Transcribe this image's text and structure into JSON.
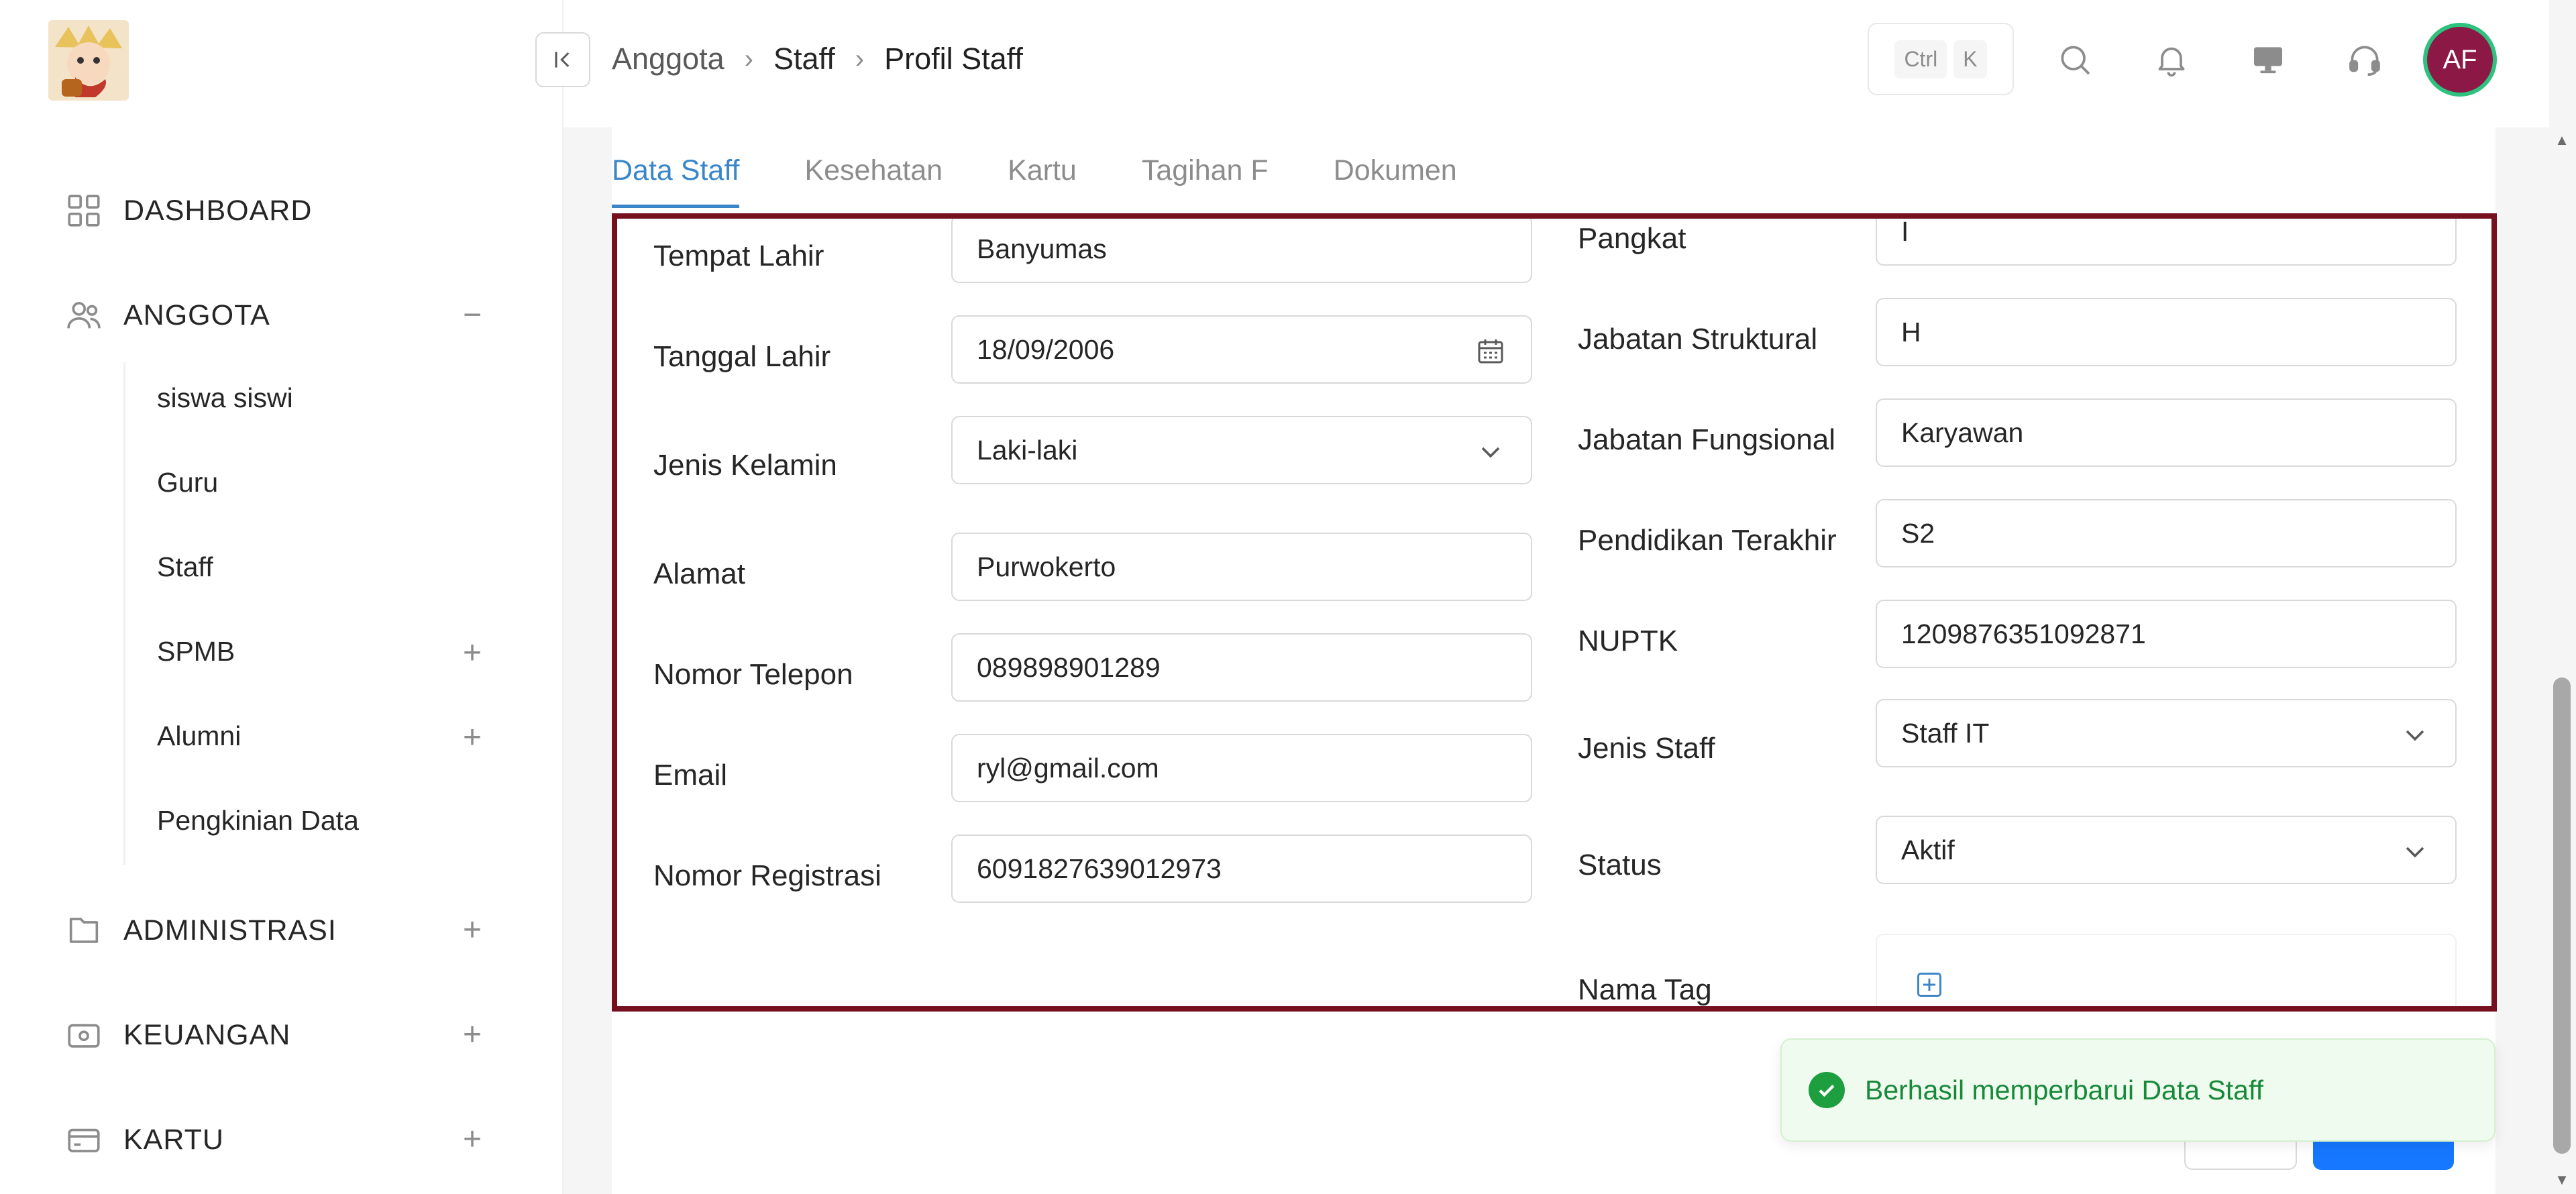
{
  "sidebar": {
    "items": [
      {
        "label": "DASHBOARD"
      },
      {
        "label": "ANGGOTA",
        "toggle": "−"
      },
      {
        "label": "ADMINISTRASI",
        "toggle": "+"
      },
      {
        "label": "KEUANGAN",
        "toggle": "+"
      },
      {
        "label": "KARTU",
        "toggle": "+"
      }
    ],
    "anggota_sub": [
      {
        "label": "siswa siswi"
      },
      {
        "label": "Guru"
      },
      {
        "label": "Staff"
      },
      {
        "label": "SPMB",
        "toggle": "+"
      },
      {
        "label": "Alumni",
        "toggle": "+"
      },
      {
        "label": "Pengkinian Data"
      }
    ]
  },
  "header": {
    "breadcrumb": [
      "Anggota",
      "Staff",
      "Profil Staff"
    ],
    "shortcut": [
      "Ctrl",
      "K"
    ],
    "avatar_initials": "AF"
  },
  "tabs": [
    "Data Staff",
    "Kesehatan",
    "Kartu",
    "Tagihan F",
    "Dokumen"
  ],
  "form_left": [
    {
      "label": "Tempat Lahir",
      "value": "Banyumas"
    },
    {
      "label": "Tanggal Lahir",
      "value": "18/09/2006"
    },
    {
      "label": "Jenis Kelamin",
      "value": "Laki-laki"
    },
    {
      "label": "Alamat",
      "value": "Purwokerto"
    },
    {
      "label": "Nomor Telepon",
      "value": "089898901289"
    },
    {
      "label": "Email",
      "value": "ryl@gmail.com"
    },
    {
      "label": "Nomor Registrasi",
      "value": "6091827639012973"
    }
  ],
  "form_right": [
    {
      "label": "Pangkat",
      "value": "I"
    },
    {
      "label": "Jabatan Struktural",
      "value": "H"
    },
    {
      "label": "Jabatan Fungsional",
      "value": "Karyawan"
    },
    {
      "label": "Pendidikan Terakhir",
      "value": "S2"
    },
    {
      "label": "NUPTK",
      "value": "1209876351092871"
    },
    {
      "label": "Jenis Staff",
      "value": "Staff IT"
    },
    {
      "label": "Status",
      "value": "Aktif"
    },
    {
      "label": "Nama Tag",
      "value": ""
    }
  ],
  "toast": {
    "message": "Berhasil memperbarui Data Staff"
  },
  "colors": {
    "accent": "#3a86c8",
    "frame": "#76101f",
    "success": "#1d9e3f",
    "primary": "#1677ff"
  }
}
